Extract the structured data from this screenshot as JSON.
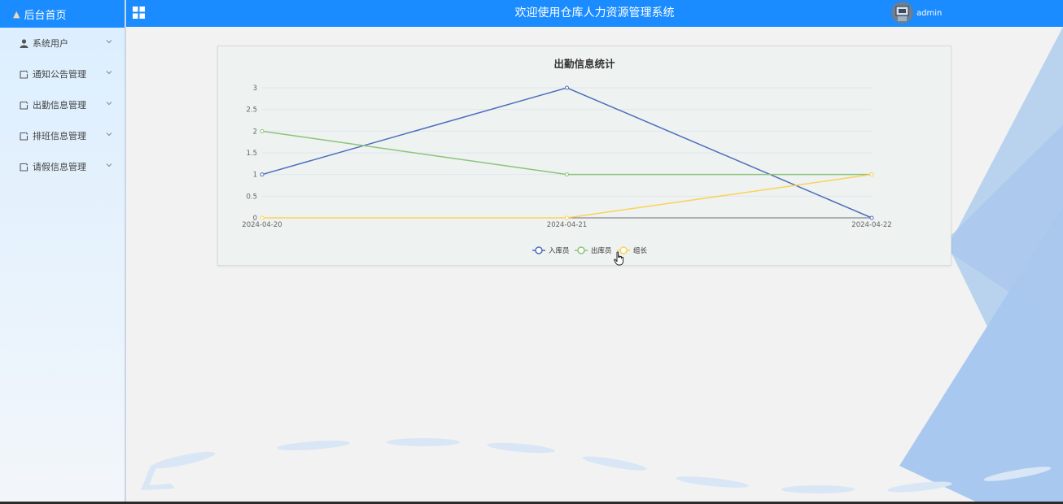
{
  "sidebar": {
    "home_label": "后台首页",
    "items": [
      {
        "label": "系统用户",
        "icon": "user-icon"
      },
      {
        "label": "通知公告管理",
        "icon": "document-icon"
      },
      {
        "label": "出勤信息管理",
        "icon": "document-icon"
      },
      {
        "label": "排班信息管理",
        "icon": "document-icon"
      },
      {
        "label": "请假信息管理",
        "icon": "document-icon"
      }
    ]
  },
  "header": {
    "title": "欢迎使用仓库人力资源管理系统",
    "username": "admin"
  },
  "colors": {
    "primary": "#1a8cff",
    "series1": "#4d6ebc",
    "series2": "#8cc47a",
    "series3": "#fdd15c"
  },
  "chart_data": {
    "type": "line",
    "title": "出勤信息统计",
    "categories": [
      "2024-04-20",
      "2024-04-21",
      "2024-04-22"
    ],
    "yticks": [
      "0",
      "0.5",
      "1",
      "1.5",
      "2",
      "2.5",
      "3"
    ],
    "ylim": [
      0,
      3
    ],
    "grid": true,
    "legend": "bottom-center",
    "series": [
      {
        "name": "入库员",
        "values": [
          1,
          3,
          0
        ],
        "color": "#4d6ebc"
      },
      {
        "name": "出库员",
        "values": [
          2,
          1,
          1
        ],
        "color": "#8cc47a"
      },
      {
        "name": "组长",
        "values": [
          0,
          0,
          1
        ],
        "color": "#fdd15c"
      }
    ]
  }
}
